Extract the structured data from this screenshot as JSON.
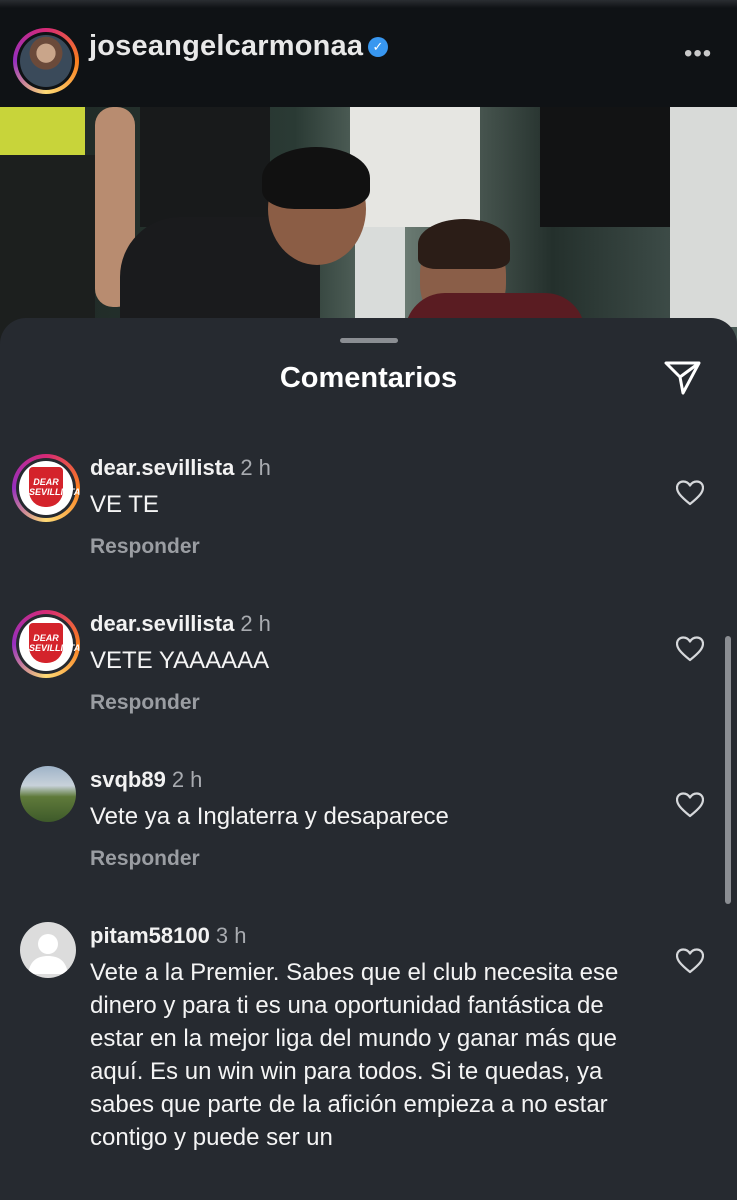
{
  "post": {
    "username": "joseangelcarmonaa",
    "verified_mark": "✓",
    "more_glyph": "•••"
  },
  "sheet": {
    "title": "Comentarios"
  },
  "comments": [
    {
      "user": "dear.sevillista",
      "time": "2 h",
      "text": "VE TE",
      "reply": "Responder",
      "avatar_text": "DEAR SEVILLISTA",
      "liked": false
    },
    {
      "user": "dear.sevillista",
      "time": "2 h",
      "text": "VETE YAAAAAA",
      "reply": "Responder",
      "avatar_text": "DEAR SEVILLISTA",
      "liked": false
    },
    {
      "user": "svqb89",
      "time": "2 h",
      "text": "Vete ya a Inglaterra y desaparece",
      "reply": "Responder",
      "liked": false
    },
    {
      "user": "pitam58100",
      "time": "3 h",
      "text": "Vete a la Premier. Sabes que el club necesita ese dinero y para ti es una oportunidad fantástica de estar en la mejor liga del mundo y ganar más que aquí. Es un win win para todos. Si te quedas, ya sabes que parte de la afición empieza a no estar contigo y puede ser un",
      "liked": false
    }
  ],
  "icons": {
    "send": "send-icon",
    "heart": "heart-icon",
    "more": "more-icon",
    "verified": "verified-badge-icon"
  },
  "colors": {
    "sheet_bg": "#262a30",
    "verified_blue": "#3897f0",
    "muted_text": "#9a9da2"
  }
}
